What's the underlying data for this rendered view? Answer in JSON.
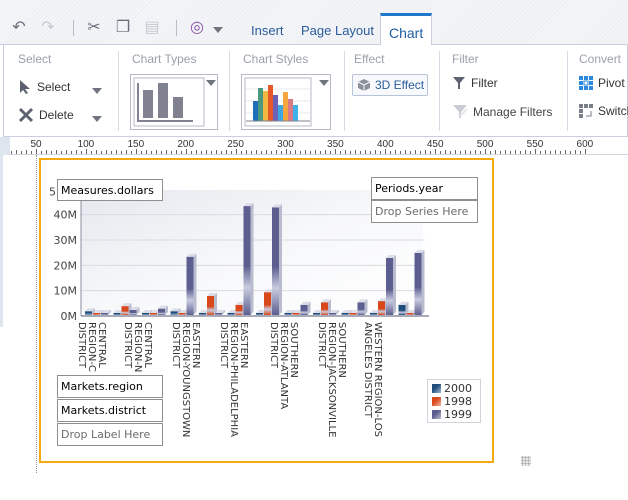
{
  "toolbar": {
    "icons": [
      "undo-icon",
      "redo-icon",
      "cut-icon",
      "copy-icon",
      "paste-icon",
      "insert-object-icon"
    ],
    "tabs": [
      {
        "label": "Insert",
        "active": false
      },
      {
        "label": "Page Layout",
        "active": false
      },
      {
        "label": "Chart",
        "active": true
      }
    ]
  },
  "ribbon": {
    "select_group": {
      "title": "Select",
      "select_label": "Select",
      "delete_label": "Delete"
    },
    "chart_types_group": {
      "title": "Chart Types"
    },
    "chart_styles_group": {
      "title": "Chart Styles"
    },
    "effect_group": {
      "title": "Effect",
      "button_label": "3D Effect"
    },
    "filter_group": {
      "title": "Filter",
      "filter_label": "Filter",
      "manage_label": "Manage Filters"
    },
    "convert_group": {
      "title": "Convert",
      "pivot_label": "Pivot",
      "switch_label": "Switch"
    }
  },
  "ruler": {
    "marks": [
      "50",
      "100",
      "150",
      "200",
      "250",
      "300",
      "350",
      "400",
      "450",
      "500",
      "550",
      "600"
    ]
  },
  "chart": {
    "measure_box": "Measures.dollars",
    "series_box": "Periods.year",
    "series_drop_hint": "Drop Series Here",
    "label_boxes": [
      "Markets.region",
      "Markets.district"
    ],
    "label_drop_hint": "Drop Label Here"
  },
  "chart_data": {
    "type": "bar",
    "title": "",
    "xlabel": "",
    "ylabel": "",
    "ylim": [
      0,
      50000000
    ],
    "yticks": [
      "0M",
      "10M",
      "20M",
      "30M",
      "40M",
      "5"
    ],
    "grid": true,
    "three_d": true,
    "legend_position": "right",
    "categories": [
      "CENTRAL REGION-C... DISTRICT",
      "CENTRAL REGION-... DISTRICT",
      "CENTRAL REGION-... DISTRICT",
      "CENTRAL REGION-... DISTRICT",
      "EASTERN REGION-YOUNGSTOWN DISTRICT",
      "EASTERN REGION-... DISTRICT",
      "EASTERN REGION-PHILADELPHIA DISTRICT",
      "SOUTHERN REGION-... DISTRICT",
      "SOUTHERN REGION-ATLANTA DISTRICT",
      "SOUTHERN REGION-... DISTRICT",
      "SOUTHERN REGION-JACKSONVILLE DISTRICT",
      "WESTERN REGION-LOS ANGELES DISTRICT"
    ],
    "x_labels_visible": [
      "CENTRAL\nREGION-C\nDISTRICT",
      "CENTRAL\nREGION-N\nDISTRICT",
      "EASTERN\nREGION-YOUNGSTOWN\nDISTRICT",
      "EASTERN\nREGION-PHILADELPHIA\nDISTRICT",
      "SOUTHERN\nREGION-ATLANTA\nDISTRICT",
      "SOUTHERN\nREGION-JACKSONVILLE\nDISTRICT",
      "WESTERN REGION-LOS\nANGELES DISTRICT"
    ],
    "series": [
      {
        "name": "2000",
        "color": "#1f4e7d",
        "values": [
          1500000,
          0,
          0,
          1500000,
          300000,
          0,
          0,
          0,
          0,
          0,
          0,
          4000000
        ]
      },
      {
        "name": "1998",
        "color": "#d9481a",
        "values": [
          300000,
          3500000,
          0,
          300000,
          7500000,
          4000000,
          9000000,
          300000,
          5000000,
          500000,
          5500000,
          300000
        ]
      },
      {
        "name": "1999",
        "color": "#5c5e8f",
        "values": [
          300000,
          2000000,
          2500000,
          23000000,
          300000,
          43000000,
          42500000,
          4000000,
          300000,
          5000000,
          22500000,
          24500000
        ]
      }
    ]
  }
}
